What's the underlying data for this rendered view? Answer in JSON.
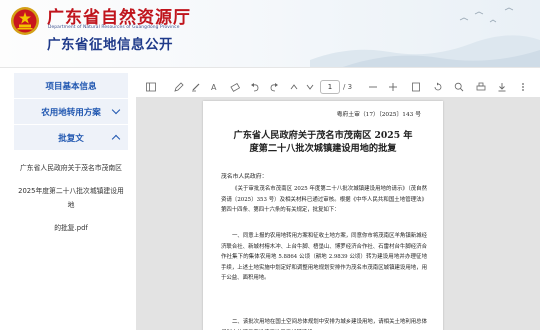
{
  "header": {
    "site_title": "广东省自然资源厅",
    "site_sub": "Department of Natural Resources of Guangdong Province",
    "site_subtitle": "广东省征地信息公开"
  },
  "sidebar": {
    "items": [
      {
        "label": "项目基本信息",
        "chevron": "none"
      },
      {
        "label": "农用地转用方案",
        "chevron": "down"
      },
      {
        "label": "批复文",
        "chevron": "up"
      }
    ],
    "file_lines": [
      "广东省人民政府关于茂名市茂南区",
      "2025年度第二十八批次城镇建设用地",
      "的批复.pdf"
    ]
  },
  "viewer": {
    "toolbar": {
      "page_current": "1",
      "page_total": "/ 3"
    },
    "doc": {
      "docno": "粤府土审（17）〔2025〕143 号",
      "title_line1": "广东省人民政府关于茂名市茂南区 2025 年",
      "title_line2": "度第二十八批次城镇建设用地的批复",
      "addressee": "茂名市人民政府：",
      "para1": "《关于审批茂名市茂南区 2025 年度第二十八批次城镇建设用地的请示》（茂自然资请〔2025〕353 号）及相关材料已通过审核。根据《中华人民共和国土地管理法》第四十四条、第四十六条的有关规定，批复如下：",
      "para2": "一、同意上报的农用地转用方案和征收土地方案，同意你市将茂南区羊角镇新城经济联合社、新城村榕木冲、上台牛脚、梧垦山、博罗经济合作社、石雷村台牛脚经济合作社集下的集体农用地 5.8864 公顷（耕地 2.9839 公顷）转为建设用地并办理征地手续，上述土地实施中划定好和调整用地规划安排作为茂名市茂南区城镇建设用地，用于公益、面积用地。",
      "para3": "二、该批次用地在国土空间总体规划中安排为城乡建设用地，请相关土地利用总体规划中的项目安排该用地用于城镇建设。"
    }
  }
}
